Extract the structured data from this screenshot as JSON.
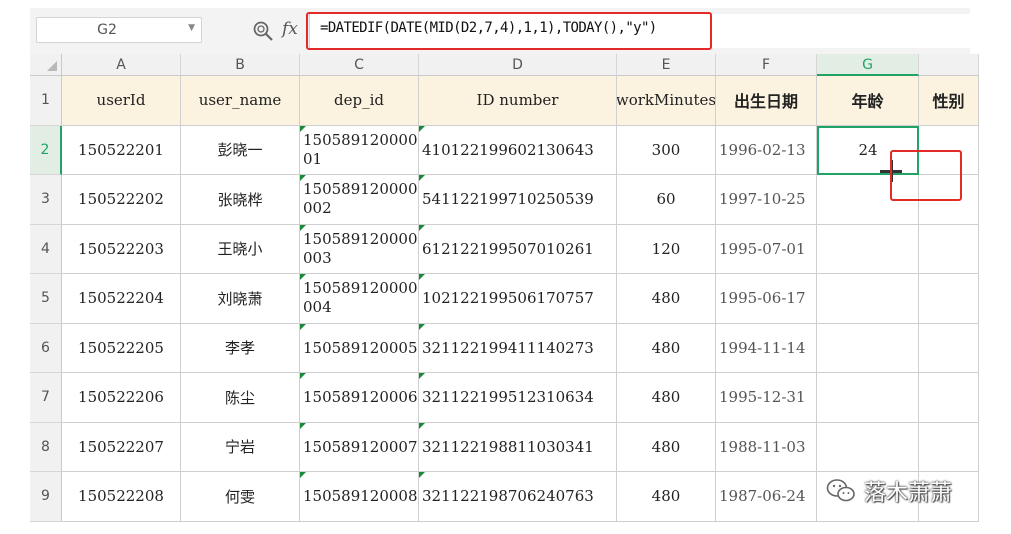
{
  "name_box": {
    "value": "G2"
  },
  "formula_bar": {
    "fx_label": "fx",
    "formula": "=DATEDIF(DATE(MID(D2,7,4),1,1),TODAY(),\"y\")"
  },
  "columns": [
    "A",
    "B",
    "C",
    "D",
    "E",
    "F",
    "G"
  ],
  "row_numbers": [
    "1",
    "2",
    "3",
    "4",
    "5",
    "6",
    "7",
    "8",
    "9"
  ],
  "headers": {
    "A": "userId",
    "B": "user_name",
    "C": "dep_id",
    "D": "ID number",
    "E": "workMinutes",
    "F": "出生日期",
    "G": "年龄",
    "H": "性别"
  },
  "rows": [
    {
      "userId": "150522201",
      "user_name": "彭晓一",
      "dep_id": "15058912000001",
      "id_number": "410122199602130643",
      "workMinutes": "300",
      "birth": "1996-02-13",
      "age": "24"
    },
    {
      "userId": "150522202",
      "user_name": "张晓桦",
      "dep_id": "150589120000002",
      "id_number": "541122199710250539",
      "workMinutes": "60",
      "birth": "1997-10-25",
      "age": ""
    },
    {
      "userId": "150522203",
      "user_name": "王晓小",
      "dep_id": "150589120000003",
      "id_number": "612122199507010261",
      "workMinutes": "120",
      "birth": "1995-07-01",
      "age": ""
    },
    {
      "userId": "150522204",
      "user_name": "刘晓萧",
      "dep_id": "150589120000004",
      "id_number": "102122199506170757",
      "workMinutes": "480",
      "birth": "1995-06-17",
      "age": ""
    },
    {
      "userId": "150522205",
      "user_name": "李孝",
      "dep_id": "150589120005",
      "id_number": "321122199411140273",
      "workMinutes": "480",
      "birth": "1994-11-14",
      "age": ""
    },
    {
      "userId": "150522206",
      "user_name": "陈尘",
      "dep_id": "150589120006",
      "id_number": "321122199512310634",
      "workMinutes": "480",
      "birth": "1995-12-31",
      "age": ""
    },
    {
      "userId": "150522207",
      "user_name": "宁岩",
      "dep_id": "150589120007",
      "id_number": "321122198811030341",
      "workMinutes": "480",
      "birth": "1988-11-03",
      "age": ""
    },
    {
      "userId": "150522208",
      "user_name": "何雯",
      "dep_id": "150589120008",
      "id_number": "321122198706240763",
      "workMinutes": "480",
      "birth": "1987-06-24",
      "age": ""
    }
  ],
  "watermark": {
    "text": "落木萧萧"
  },
  "colors": {
    "accent_green": "#21a366",
    "highlight_red": "#e42a26",
    "header_fill": "#fbf3e0"
  }
}
